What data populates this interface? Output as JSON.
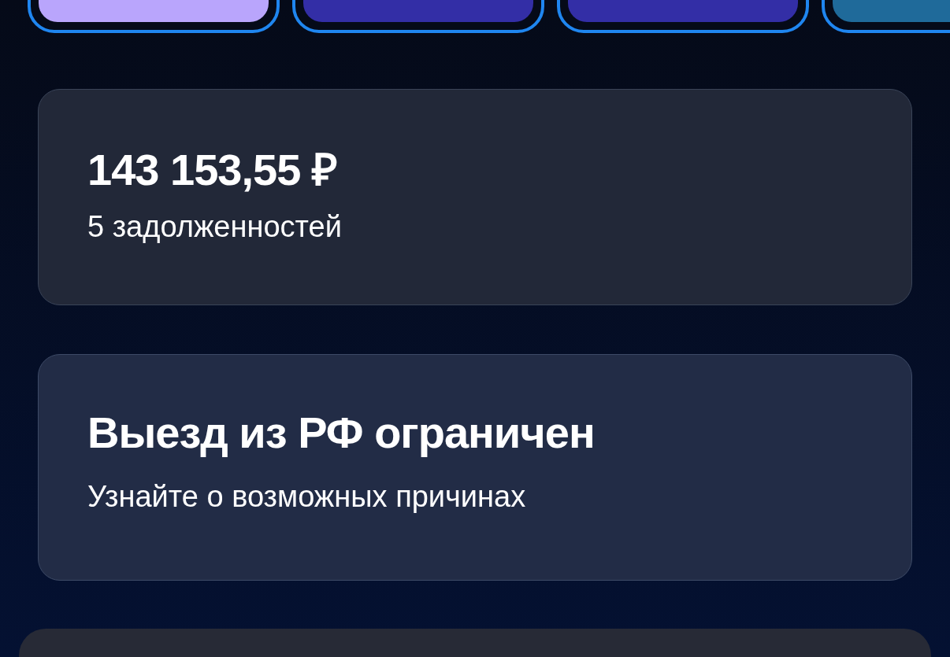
{
  "tiles": [
    {
      "color": "#b9a5fc"
    },
    {
      "color": "#332ea6"
    },
    {
      "color": "#332ea6"
    },
    {
      "color": "#1f6a9a"
    }
  ],
  "debt_card": {
    "amount": "143 153,55 ₽",
    "subtitle": "5 задолженностей"
  },
  "travel_card": {
    "title": "Выезд из РФ ограничен",
    "subtitle": "Узнайте о возможных причинах"
  }
}
